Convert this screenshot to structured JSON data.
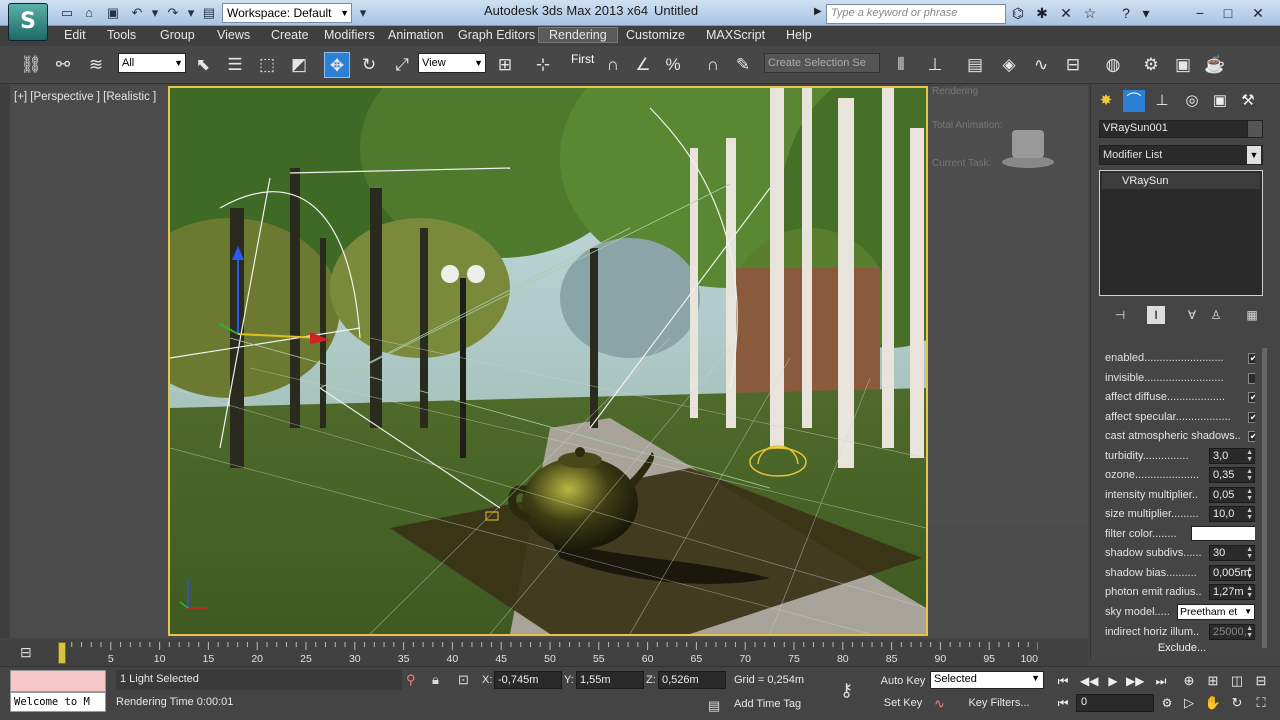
{
  "titlebar": {
    "logo": "S",
    "workspace": "Workspace: Default",
    "app_title": "Autodesk 3ds Max  2013 x64",
    "doc_title": "Untitled",
    "search_placeholder": "Type a keyword or phrase"
  },
  "menu": [
    "Edit",
    "Tools",
    "Group",
    "Views",
    "Create",
    "Modifiers",
    "Animation",
    "Graph Editors",
    "Rendering",
    "Customize",
    "MAXScript",
    "Help"
  ],
  "toolbar": {
    "selection_filter": "All",
    "ref_coord": "View",
    "named_selection_set": "Create Selection Se",
    "flyout_label": "First"
  },
  "viewport": {
    "label": "[+] [Perspective ] [Realistic ]",
    "ghost_lines": [
      "Rendering",
      "Total Animation:",
      "Current Task:"
    ]
  },
  "command_panel": {
    "object_name": "VRaySun001",
    "modifier_list": "Modifier List",
    "stack_item": "VRaySun",
    "params": [
      {
        "label": "enabled..........................",
        "type": "check",
        "value": true
      },
      {
        "label": "invisible..........................",
        "type": "check",
        "value": false
      },
      {
        "label": "affect diffuse...................",
        "type": "check",
        "value": true
      },
      {
        "label": "affect specular..................",
        "type": "check",
        "value": true
      },
      {
        "label": "cast atmospheric shadows..",
        "type": "check",
        "value": true
      },
      {
        "label": "turbidity...............",
        "type": "spin",
        "value": "3,0"
      },
      {
        "label": "ozone.....................",
        "type": "spin",
        "value": "0,35"
      },
      {
        "label": "intensity multiplier..",
        "type": "spin",
        "value": "0,05"
      },
      {
        "label": "size multiplier.........",
        "type": "spin",
        "value": "10,0"
      },
      {
        "label": "filter color........",
        "type": "color",
        "value": "#ffffff"
      },
      {
        "label": "shadow subdivs......",
        "type": "spin",
        "value": "30"
      },
      {
        "label": "shadow bias..........",
        "type": "spin",
        "value": "0,005m"
      },
      {
        "label": "photon emit radius..",
        "type": "spin",
        "value": "1,27m"
      },
      {
        "label": "sky model.....",
        "type": "drop",
        "value": "Preetham et"
      },
      {
        "label": "indirect horiz illum..",
        "type": "spin",
        "value": "25000,"
      }
    ],
    "exclude": "Exclude..."
  },
  "timeline": {
    "ticks": [
      5,
      10,
      15,
      20,
      25,
      30,
      35,
      40,
      45,
      50,
      55,
      60,
      65,
      70,
      75,
      80,
      85,
      90,
      95,
      100
    ],
    "current_frame": 0
  },
  "status": {
    "maxscript_output": "",
    "maxscript_input": "Welcome to M",
    "selection": "1 Light Selected",
    "render_time": "Rendering Time  0:00:01",
    "x_label": "X:",
    "x_value": "-0,745m",
    "y_label": "Y:",
    "y_value": "1,55m",
    "z_label": "Z:",
    "z_value": "0,526m",
    "grid": "Grid = 0,254m",
    "add_time_tag": "Add Time Tag",
    "auto_key": "Auto Key",
    "set_key": "Set Key",
    "key_selection": "Selected",
    "key_filters": "Key Filters...",
    "frame": "0"
  },
  "colors": {
    "accent_blue": "#2b7fd4",
    "viewport_border": "#e6c44a",
    "maxscript_listener": "#f6c8c8"
  }
}
